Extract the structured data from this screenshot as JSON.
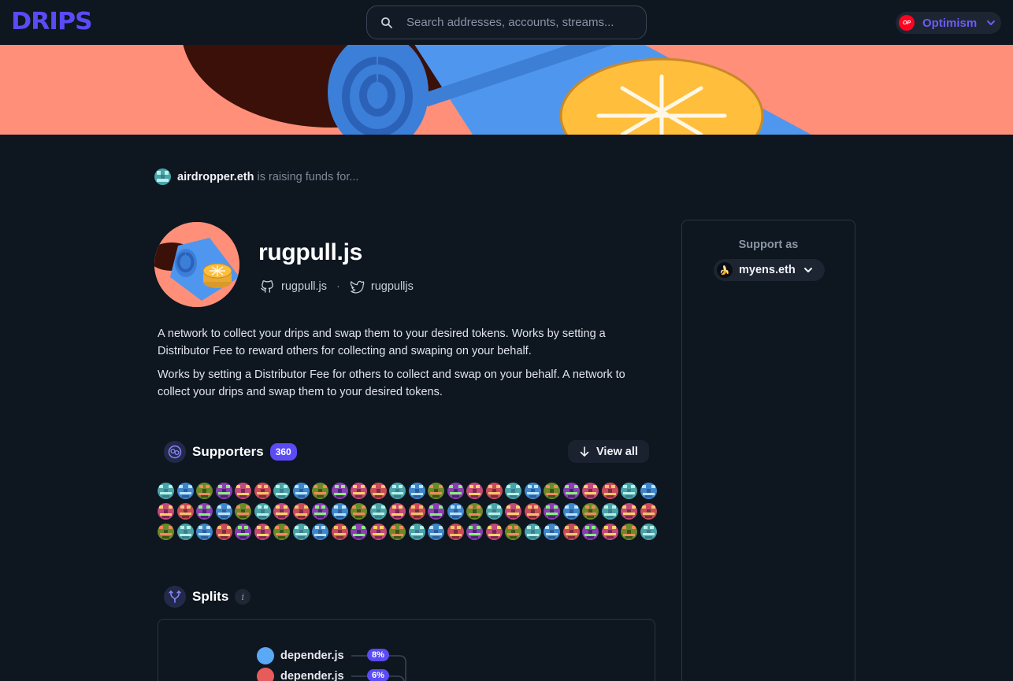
{
  "header": {
    "logo": "DRIPS",
    "search_placeholder": "Search addresses, accounts, streams...",
    "network": "Optimism",
    "network_badge": "OP"
  },
  "owner": {
    "name": "airdropper.eth",
    "suffix": "is raising funds for..."
  },
  "project": {
    "title": "rugpull.js",
    "github": "rugpull.js",
    "separator": "·",
    "twitter": "rugpulljs",
    "description": [
      "A network to collect your drips and swap them to your desired tokens. Works by setting a Distributor Fee to reward others for collecting and swaping on your behalf.",
      "Works by setting a Distributor Fee for others to collect and swap on your behalf. A network to collect your drips and swap them to your desired tokens."
    ]
  },
  "supporters": {
    "title": "Supporters",
    "count": "360",
    "view_all": "View all",
    "rows": 3,
    "per_row": 26
  },
  "splits": {
    "title": "Splits",
    "info": "i",
    "items": [
      {
        "name": "depender.js",
        "percent": "8%",
        "color": "#5aa9f5"
      },
      {
        "name": "depender.js",
        "percent": "6%",
        "color": "#e85b5b"
      }
    ]
  },
  "sidebar": {
    "support_as": "Support as",
    "identity": "myens.eth"
  },
  "colors": {
    "accent": "#5a4bf5",
    "background": "#0e1620",
    "banner": "#ff8f78"
  }
}
